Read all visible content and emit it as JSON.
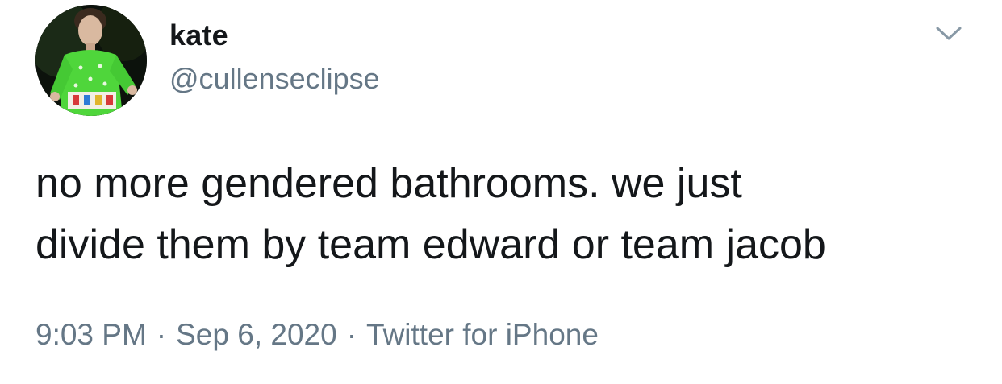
{
  "user": {
    "display_name": "kate",
    "handle": "@cullenseclipse",
    "avatar_icon": "profile-photo"
  },
  "menu": {
    "icon": "chevron-down-icon"
  },
  "tweet": {
    "text": "no more gendered bathrooms. we just\ndivide them by team edward or team jacob"
  },
  "meta": {
    "time": "9:03 PM",
    "separator": "·",
    "date": "Sep 6, 2020",
    "source": "Twitter for iPhone"
  },
  "colors": {
    "text_primary": "#14171a",
    "text_secondary": "#657786",
    "background": "#ffffff"
  }
}
